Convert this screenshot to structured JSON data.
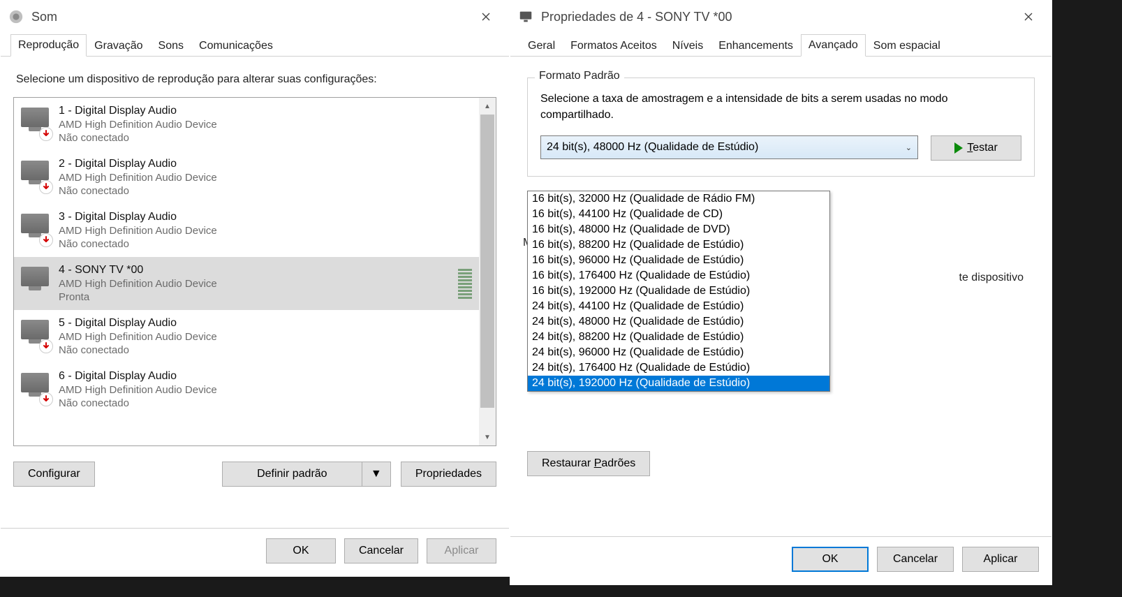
{
  "sound": {
    "title": "Som",
    "tabs": [
      "Reprodução",
      "Gravação",
      "Sons",
      "Comunicações"
    ],
    "active_tab": 0,
    "instruction": "Selecione um dispositivo de reprodução para alterar suas configurações:",
    "devices": [
      {
        "name": "1 - Digital Display Audio",
        "driver": "AMD High Definition Audio Device",
        "status": "Não conectado",
        "connected": false,
        "selected": false
      },
      {
        "name": "2 - Digital Display Audio",
        "driver": "AMD High Definition Audio Device",
        "status": "Não conectado",
        "connected": false,
        "selected": false
      },
      {
        "name": "3 - Digital Display Audio",
        "driver": "AMD High Definition Audio Device",
        "status": "Não conectado",
        "connected": false,
        "selected": false
      },
      {
        "name": "4 - SONY TV  *00",
        "driver": "AMD High Definition Audio Device",
        "status": "Pronta",
        "connected": true,
        "selected": true
      },
      {
        "name": "5 - Digital Display Audio",
        "driver": "AMD High Definition Audio Device",
        "status": "Não conectado",
        "connected": false,
        "selected": false
      },
      {
        "name": "6 - Digital Display Audio",
        "driver": "AMD High Definition Audio Device",
        "status": "Não conectado",
        "connected": false,
        "selected": false
      }
    ],
    "buttons": {
      "configure": "Configurar",
      "set_default": "Definir padrão",
      "properties": "Propriedades",
      "ok": "OK",
      "cancel": "Cancelar",
      "apply": "Aplicar"
    }
  },
  "props": {
    "title": "Propriedades de 4 - SONY TV  *00",
    "tabs": [
      "Geral",
      "Formatos Aceitos",
      "Níveis",
      "Enhancements",
      "Avançado",
      "Som espacial"
    ],
    "active_tab": 4,
    "group1": {
      "legend": "Formato Padrão",
      "text": "Selecione a taxa de amostragem e a intensidade de bits a serem usadas no modo compartilhado.",
      "selected": "24 bit(s), 48000 Hz (Qualidade de Estúdio)",
      "test": "Testar",
      "options": [
        "16 bit(s), 32000 Hz (Qualidade de Rádio FM)",
        "16 bit(s), 44100 Hz (Qualidade de CD)",
        "16 bit(s), 48000 Hz (Qualidade de DVD)",
        "16 bit(s), 88200 Hz (Qualidade de Estúdio)",
        "16 bit(s), 96000 Hz (Qualidade de Estúdio)",
        "16 bit(s), 176400 Hz (Qualidade de Estúdio)",
        "16 bit(s), 192000 Hz (Qualidade de Estúdio)",
        "24 bit(s), 44100 Hz (Qualidade de Estúdio)",
        "24 bit(s), 48000 Hz (Qualidade de Estúdio)",
        "24 bit(s), 88200 Hz (Qualidade de Estúdio)",
        "24 bit(s), 96000 Hz (Qualidade de Estúdio)",
        "24 bit(s), 176400 Hz (Qualidade de Estúdio)",
        "24 bit(s), 192000 Hz (Qualidade de Estúdio)"
      ],
      "hover_index": 12
    },
    "hidden": {
      "m_label": "M",
      "exclusive_fragment": "te dispositivo"
    },
    "restore": "Restaurar Padrões",
    "buttons": {
      "ok": "OK",
      "cancel": "Cancelar",
      "apply": "Aplicar"
    }
  }
}
